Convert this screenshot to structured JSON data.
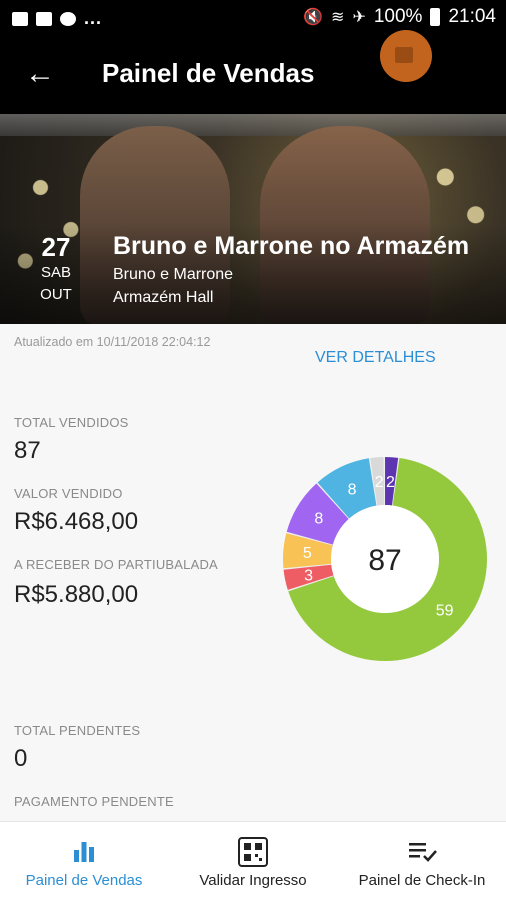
{
  "status_bar": {
    "battery": "100%",
    "time": "21:04",
    "dots": "..."
  },
  "app_bar": {
    "title": "Painel de Vendas"
  },
  "event": {
    "day": "27",
    "weekday": "SAB",
    "month": "OUT",
    "title": "Bruno e Marrone no Armazém",
    "artist": "Bruno e Marrone",
    "venue": "Armazém Hall"
  },
  "summary": {
    "updated_text": "Atualizado em 10/11/2018 22:04:12",
    "details_link": "VER DETALHES",
    "total_sold_label": "TOTAL VENDIDOS",
    "total_sold_value": "87",
    "amount_sold_label": "VALOR VENDIDO",
    "amount_sold_value": "R$6.468,00",
    "receivable_label": "A RECEBER DO PARTIUBALADA",
    "receivable_value": "R$5.880,00",
    "pending_total_label": "TOTAL PENDENTES",
    "pending_total_value": "0",
    "pending_payment_label": "PAGAMENTO PENDENTE"
  },
  "chart_data": {
    "type": "pie",
    "center_label": "87",
    "series": [
      {
        "value": 59,
        "label": "59",
        "color": "#95c93d"
      },
      {
        "value": 3,
        "label": "3",
        "color": "#ef5d64"
      },
      {
        "value": 5,
        "label": "5",
        "color": "#f8c255"
      },
      {
        "value": 8,
        "label": "8",
        "color": "#a066f1"
      },
      {
        "value": 8,
        "label": "8",
        "color": "#4fb4e2"
      },
      {
        "value": 2,
        "label": "2",
        "color": "#d9d9d9"
      },
      {
        "value": 2,
        "label": "2",
        "color": "#5e35b1"
      }
    ]
  },
  "bottom_nav": {
    "items": [
      {
        "label": "Painel de Vendas",
        "icon": "bar-chart-icon",
        "active": true
      },
      {
        "label": "Validar Ingresso",
        "icon": "qr-code-icon",
        "active": false
      },
      {
        "label": "Painel de Check-In",
        "icon": "checklist-icon",
        "active": false
      }
    ]
  },
  "colors": {
    "accent": "#2b8fd6",
    "app_bar": "#000000"
  }
}
